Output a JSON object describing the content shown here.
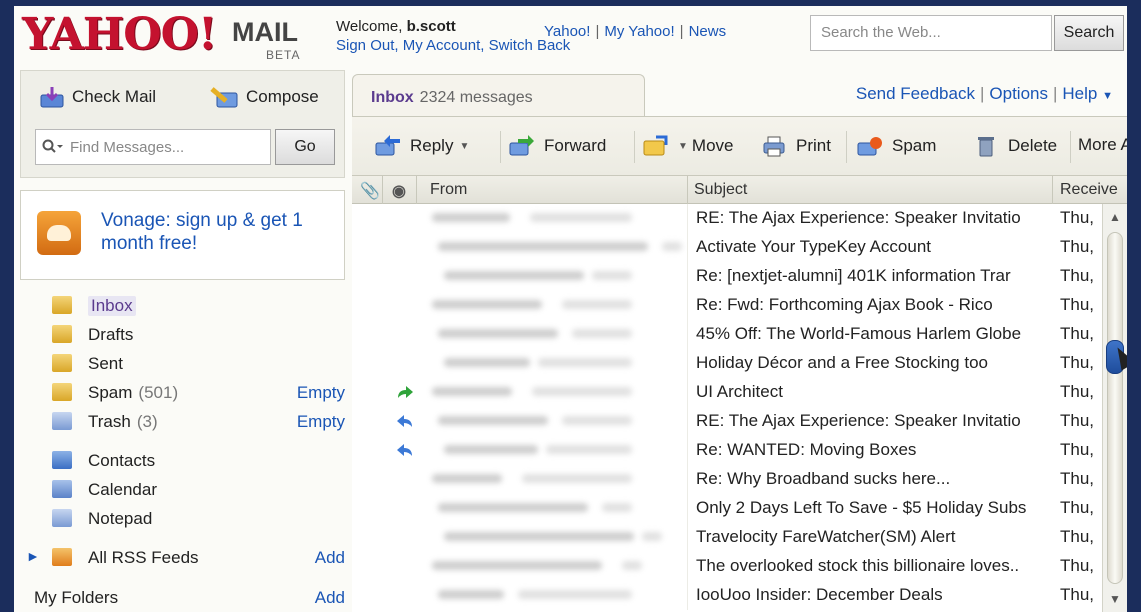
{
  "header": {
    "logo_text": "YAHOO!",
    "logo_mail": "MAIL",
    "logo_beta": "BETA",
    "welcome_prefix": "Welcome, ",
    "username": "b.scott",
    "top_links": [
      "Yahoo!",
      "My Yahoo!",
      "News"
    ],
    "account_links": [
      "Sign Out",
      "My Account",
      "Switch Back"
    ],
    "search_placeholder": "Search the Web...",
    "search_button": "Search"
  },
  "sidebar": {
    "check_mail": "Check Mail",
    "compose": "Compose",
    "find_placeholder": "Find Messages...",
    "go": "Go",
    "promo": "Vonage: sign up & get 1 month free!",
    "folders": [
      {
        "label": "Inbox",
        "count": "",
        "action": ""
      },
      {
        "label": "Drafts",
        "count": "",
        "action": ""
      },
      {
        "label": "Sent",
        "count": "",
        "action": ""
      },
      {
        "label": "Spam",
        "count": "(501)",
        "action": "Empty"
      },
      {
        "label": "Trash",
        "count": "(3)",
        "action": "Empty"
      }
    ],
    "apps": [
      "Contacts",
      "Calendar",
      "Notepad"
    ],
    "rss": {
      "label": "All RSS Feeds",
      "action": "Add"
    },
    "my_folders": {
      "label": "My Folders",
      "action": "Add"
    }
  },
  "tabs": {
    "inbox_label": "Inbox",
    "inbox_count": "2324 messages",
    "links": [
      "Send Feedback",
      "Options",
      "Help"
    ]
  },
  "toolbar": {
    "reply": "Reply",
    "forward": "Forward",
    "move": "Move",
    "print": "Print",
    "spam": "Spam",
    "delete": "Delete",
    "more": "More A"
  },
  "list": {
    "columns": {
      "from": "From",
      "subject": "Subject",
      "received": "Receive"
    },
    "rows": [
      {
        "subject": "RE: The Ajax Experience: Speaker Invitatio",
        "received": "Thu,",
        "icon": ""
      },
      {
        "subject": "Activate Your TypeKey Account",
        "received": "Thu,",
        "icon": ""
      },
      {
        "subject": "Re: [nextjet-alumni] 401K information Trar",
        "received": "Thu,",
        "icon": ""
      },
      {
        "subject": "Re: Fwd: Forthcoming Ajax Book - Rico",
        "received": "Thu,",
        "icon": ""
      },
      {
        "subject": "45% Off: The World-Famous Harlem Globe",
        "received": "Thu,",
        "icon": ""
      },
      {
        "subject": "Holiday Décor and a Free Stocking too",
        "received": "Thu,",
        "icon": ""
      },
      {
        "subject": "UI Architect",
        "received": "Thu,",
        "icon": "forwarded-icon"
      },
      {
        "subject": "RE: The Ajax Experience: Speaker Invitatio",
        "received": "Thu,",
        "icon": "replied-icon"
      },
      {
        "subject": "Re: WANTED: Moving Boxes",
        "received": "Thu,",
        "icon": "replied-icon"
      },
      {
        "subject": "Re: Why Broadband sucks here...",
        "received": "Thu,",
        "icon": ""
      },
      {
        "subject": "Only 2 Days Left To Save - $5 Holiday Subs",
        "received": "Thu,",
        "icon": ""
      },
      {
        "subject": "Travelocity FareWatcher(SM) Alert",
        "received": "Thu,",
        "icon": ""
      },
      {
        "subject": "The overlooked stock this billionaire loves..",
        "received": "Thu,",
        "icon": ""
      },
      {
        "subject": "IooUoo Insider: December Deals",
        "received": "Thu,",
        "icon": ""
      }
    ]
  }
}
